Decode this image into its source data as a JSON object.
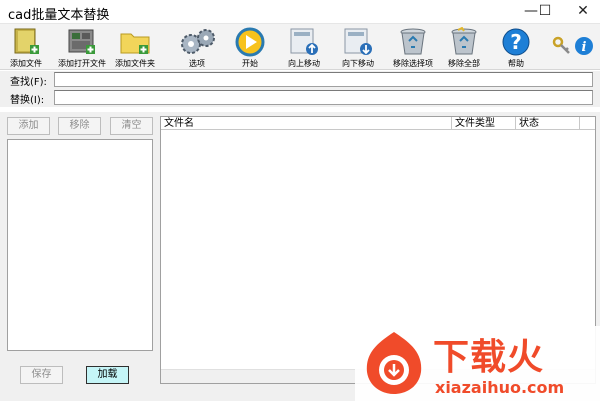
{
  "window": {
    "title": "cad批量文本替换",
    "minimize": "—",
    "maximize": "☐",
    "close": "✕"
  },
  "toolbar": {
    "add_file": "添加文件",
    "add_open_file": "添加打开文件",
    "add_folder": "添加文件夹",
    "options": "选项",
    "start": "开始",
    "move_up": "向上移动",
    "move_down": "向下移动",
    "remove_selected": "移除选择项",
    "remove_all": "移除全部",
    "help": "帮助"
  },
  "find": {
    "label": "查找(F):",
    "value": ""
  },
  "replace": {
    "label": "替换(I):",
    "value": ""
  },
  "left_panel": {
    "add": "添加",
    "remove": "移除",
    "clear": "清空",
    "save": "保存",
    "load": "加载"
  },
  "table": {
    "columns": [
      "文件名",
      "文件类型",
      "状态"
    ]
  },
  "watermark": {
    "text": "下载火",
    "site": "xiazaihuo.com"
  }
}
